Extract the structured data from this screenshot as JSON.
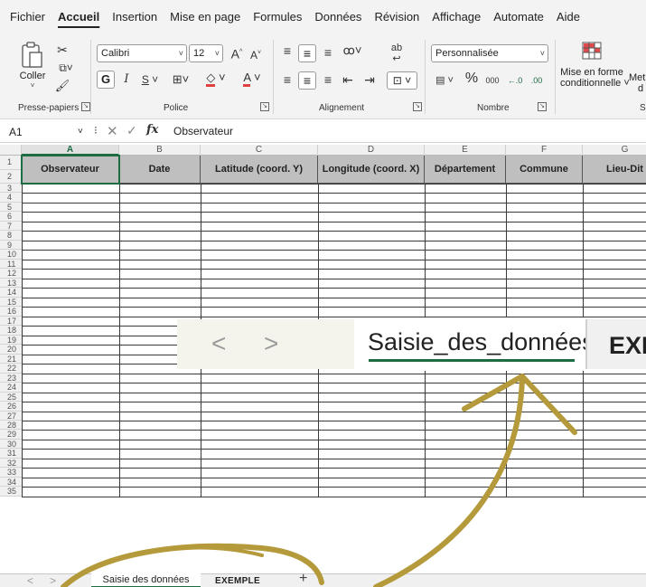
{
  "menu_tabs": [
    "Fichier",
    "Accueil",
    "Insertion",
    "Mise en page",
    "Formules",
    "Données",
    "Révision",
    "Affichage",
    "Automate",
    "Aide"
  ],
  "active_menu_tab": "Accueil",
  "ribbon": {
    "clipboard": {
      "paste_label": "Coller",
      "group_label": "Presse-papiers"
    },
    "font": {
      "name": "Calibri",
      "size": "12",
      "bold": "G",
      "italic": "I",
      "underline": "S",
      "group_label": "Police"
    },
    "alignment": {
      "group_label": "Alignement"
    },
    "number": {
      "format": "Personnalisée",
      "percent": "%",
      "thousands": "000",
      "inc_decimal": "←.0",
      "dec_decimal": ".00",
      "group_label": "Nombre"
    },
    "styles": {
      "cond_format_line1": "Mise en forme",
      "cond_format_line2": "conditionnelle ˅",
      "more_line1": "Met",
      "more_line2": "d",
      "group_label_partial": "S"
    }
  },
  "formula_bar": {
    "name_box": "A1",
    "content": "Observateur"
  },
  "grid": {
    "columns": [
      "A",
      "B",
      "C",
      "D",
      "E",
      "F",
      "G"
    ],
    "selected_column": "A",
    "headers": [
      "Observateur",
      "Date",
      "Latitude (coord. Y)",
      "Longitude (coord. X)",
      "Département",
      "Commune",
      "Lieu-Dit"
    ],
    "row_numbers": [
      "1",
      "2",
      "3",
      "4",
      "5",
      "6",
      "7",
      "8",
      "9",
      "10",
      "11",
      "12",
      "13",
      "14",
      "15",
      "16",
      "17",
      "18",
      "19",
      "20",
      "21",
      "22",
      "23",
      "24",
      "25",
      "26",
      "27",
      "28",
      "29",
      "30",
      "31",
      "32",
      "33",
      "34",
      "35"
    ]
  },
  "sheet_tabs": {
    "active": "Saisie des données",
    "other": "EXEMPLE",
    "add": "+",
    "prev": "<",
    "next": ">"
  },
  "callout": {
    "active_tab": "Saisie_des_données",
    "other_tab": "EXE",
    "prev": "<",
    "next": ">"
  },
  "colors": {
    "accent_green": "#1e6c41",
    "annotation_gold": "#b59a3c",
    "header_fill": "#bfbfbf"
  }
}
